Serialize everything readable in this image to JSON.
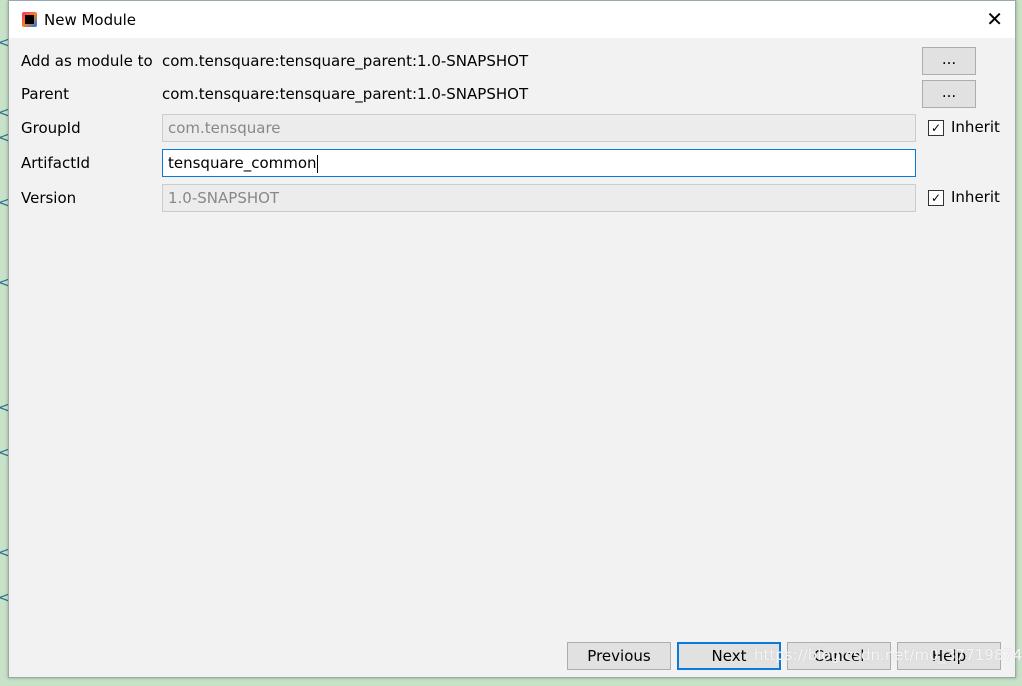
{
  "window": {
    "title": "New Module",
    "close_icon": "close-icon"
  },
  "fields": {
    "add_as_module_to": {
      "label": "Add as module to",
      "value": "com.tensquare:tensquare_parent:1.0-SNAPSHOT",
      "button": "..."
    },
    "parent": {
      "label": "Parent",
      "value": "com.tensquare:tensquare_parent:1.0-SNAPSHOT",
      "button": "..."
    },
    "group_id": {
      "label": "GroupId",
      "value": "com.tensquare",
      "inherit_label": "Inherit",
      "inherit_checked": true
    },
    "artifact_id": {
      "label": "ArtifactId",
      "value": "tensquare_common"
    },
    "version": {
      "label": "Version",
      "value": "1.0-SNAPSHOT",
      "inherit_label": "Inherit",
      "inherit_checked": true
    }
  },
  "buttons": {
    "previous": "Previous",
    "next": "Next",
    "cancel": "Cancel",
    "help": "Help"
  },
  "watermark": "https://blog.csdn.net/m0_37719874",
  "colors": {
    "focus": "#0a7ad8",
    "dialog_bg": "#f2f2f2"
  }
}
